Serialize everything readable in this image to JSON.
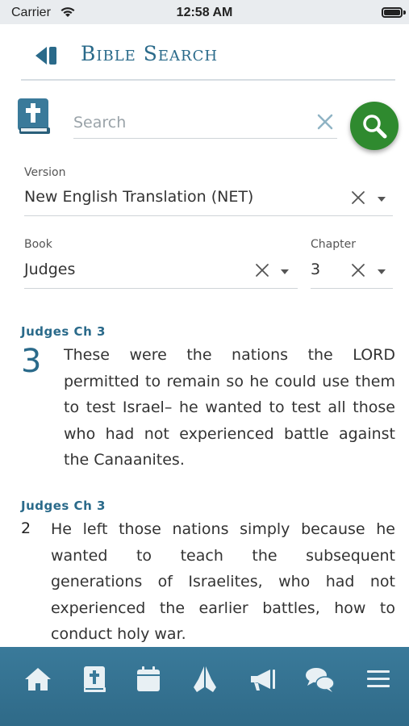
{
  "status": {
    "carrier": "Carrier",
    "time": "12:58 AM"
  },
  "header": {
    "title": "Bible Search"
  },
  "search": {
    "placeholder": "Search",
    "value": ""
  },
  "filters": {
    "version_label": "Version",
    "version_value": "New English Translation (NET)",
    "book_label": "Book",
    "book_value": "Judges",
    "chapter_label": "Chapter",
    "chapter_value": "3"
  },
  "results": [
    {
      "reference": "Judges Ch 3",
      "verse": "3",
      "text": "These were the nations the LORD permitted to remain so he could use them to test Israel– he wanted to test all those who had not experienced battle against the Canaanites."
    },
    {
      "reference": "Judges Ch 3",
      "verse": "2",
      "text": "He left those nations simply because he wanted to teach the subsequent generations of Israelites, who had not experienced the earlier battles, how to conduct holy war."
    }
  ],
  "nav": [
    "home-icon",
    "bible-icon",
    "calendar-icon",
    "praying-hands-icon",
    "megaphone-icon",
    "chat-icon",
    "menu-icon"
  ],
  "colors": {
    "accent": "#2a6a8a",
    "search_button": "#2f8a2f",
    "nav_background": "#3a7a9a"
  }
}
